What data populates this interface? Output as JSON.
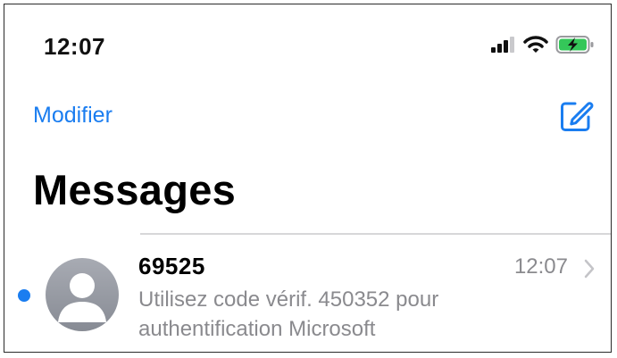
{
  "status_bar": {
    "time": "12:07",
    "icons": [
      "cellular-signal-icon",
      "wifi-icon",
      "battery-charging-icon"
    ],
    "battery_color": "#34c759"
  },
  "nav": {
    "edit_label": "Modifier",
    "compose_icon": "compose-icon"
  },
  "page": {
    "title": "Messages"
  },
  "conversations": [
    {
      "sender": "69525",
      "time": "12:07",
      "preview_line1": "Utilisez code vérif. 450352 pour",
      "preview_line2": "authentification Microsoft",
      "unread": true
    }
  ],
  "colors": {
    "accent": "#1a7df0",
    "secondary_text": "#8a8a8e",
    "divider": "#d7d7d9"
  }
}
